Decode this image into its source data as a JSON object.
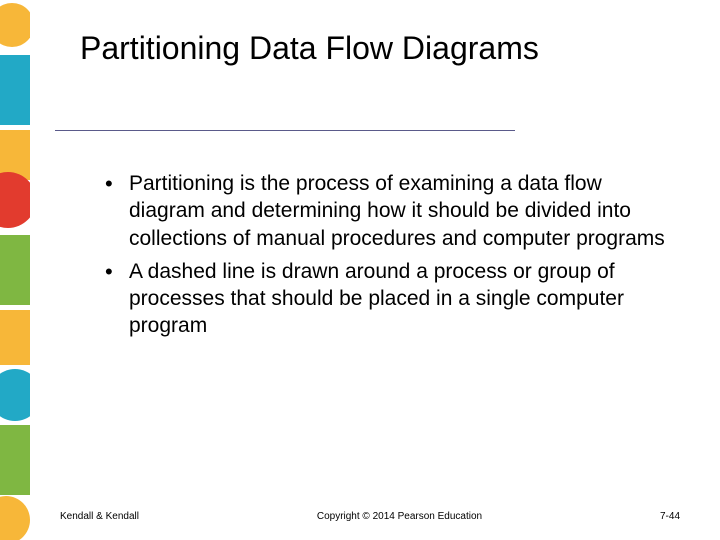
{
  "title": "Partitioning Data Flow Diagrams",
  "bullets": [
    "Partitioning is the process of examining a data flow diagram and determining how it should be divided into collections of manual procedures and computer programs",
    "A dashed line is drawn around a process or group of processes that should be placed in a single computer program"
  ],
  "footer": {
    "left": "Kendall & Kendall",
    "center": "Copyright © 2014 Pearson Education",
    "right": "7-44"
  }
}
